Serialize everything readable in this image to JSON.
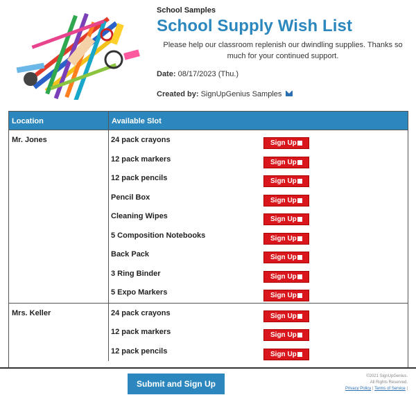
{
  "header": {
    "organization": "School Samples",
    "title": "School Supply Wish List",
    "description": "Please help our classroom replenish our dwindling supplies. Thanks so much for your continued support.",
    "date_label": "Date:",
    "date_value": "08/17/2023 (Thu.)",
    "created_label": "Created by:",
    "created_value": "SignUpGenius Samples"
  },
  "table": {
    "headers": {
      "location": "Location",
      "slot": "Available Slot"
    },
    "signup_label": "Sign Up",
    "groups": [
      {
        "location": "Mr. Jones",
        "slots": [
          "24 pack crayons",
          "12 pack markers",
          "12 pack pencils",
          "Pencil Box",
          "Cleaning Wipes",
          "5 Composition Notebooks",
          "Back Pack",
          "3 Ring Binder",
          "5 Expo Markers"
        ]
      },
      {
        "location": "Mrs. Keller",
        "slots": [
          "24 pack crayons",
          "12 pack markers",
          "12 pack pencils"
        ]
      }
    ]
  },
  "footer": {
    "submit_label": "Submit and Sign Up",
    "copyright": "©2021 SignUpGenius.",
    "rights": "All Rights Reserved.",
    "privacy": "Privacy Policy",
    "separator": "|",
    "terms": "Terms of Service",
    "separator2": "|"
  },
  "colors": {
    "accent": "#2b87bd",
    "button_red": "#d8161b"
  },
  "icons": {
    "email": "envelope-icon"
  }
}
